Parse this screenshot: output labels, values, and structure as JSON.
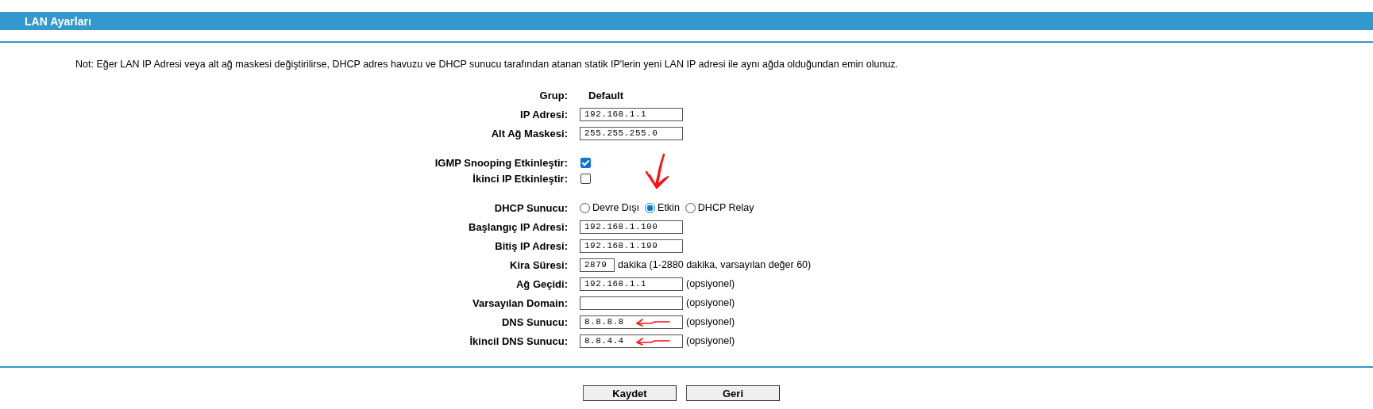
{
  "header": {
    "title": "LAN Ayarları"
  },
  "note": "Not: Eğer LAN IP Adresi veya alt ağ maskesi değiştirilirse, DHCP adres havuzu ve DHCP sunucu tarafından atanan statik IP'lerin yeni LAN IP adresi ile aynı ağda olduğundan emin olunuz.",
  "groups": [
    [
      {
        "kind": "text",
        "label": "Grup:",
        "value": "Default"
      },
      {
        "kind": "input",
        "label": "IP Adresi:",
        "value": "192.168.1.1"
      },
      {
        "kind": "input",
        "label": "Alt Ağ Maskesi:",
        "value": "255.255.255.0"
      }
    ],
    [
      {
        "kind": "checkbox",
        "label": "IGMP Snooping Etkinleştir:",
        "checked": true
      },
      {
        "kind": "checkbox",
        "label": "İkinci IP Etkinleştir:",
        "checked": false
      }
    ],
    [
      {
        "kind": "radio",
        "label": "DHCP Sunucu:",
        "options": [
          {
            "label": "Devre Dışı",
            "selected": false,
            "arrow_mark": false
          },
          {
            "label": "Etkin",
            "selected": true,
            "arrow_mark": true
          },
          {
            "label": "DHCP Relay",
            "selected": false,
            "arrow_mark": false
          }
        ]
      },
      {
        "kind": "input",
        "label": "Başlangıç IP Adresi:",
        "value": "192.168.1.100"
      },
      {
        "kind": "input",
        "label": "Bitiş IP Adresi:",
        "value": "192.168.1.199"
      },
      {
        "kind": "short_input",
        "label": "Kira Süresi:",
        "value": "2879",
        "suffix": "dakika (1-2880 dakika, varsayılan değer 60)"
      },
      {
        "kind": "input",
        "label": "Ağ Geçidi:",
        "value": "192.168.1.1",
        "suffix": "(opsiyonel)"
      },
      {
        "kind": "input",
        "label": "Varsayılan Domain:",
        "suffix": "(opsiyonel)"
      },
      {
        "kind": "input",
        "label": "DNS Sunucu:",
        "value": "8.8.8.8",
        "suffix": "(opsiyonel)",
        "arrow_mark": true
      },
      {
        "kind": "input",
        "label": "İkincil DNS Sunucu:",
        "value": "8.8.4.4",
        "suffix": "(opsiyonel)",
        "arrow_mark": true
      }
    ]
  ],
  "buttons": [
    "Kaydet",
    "Geri"
  ]
}
